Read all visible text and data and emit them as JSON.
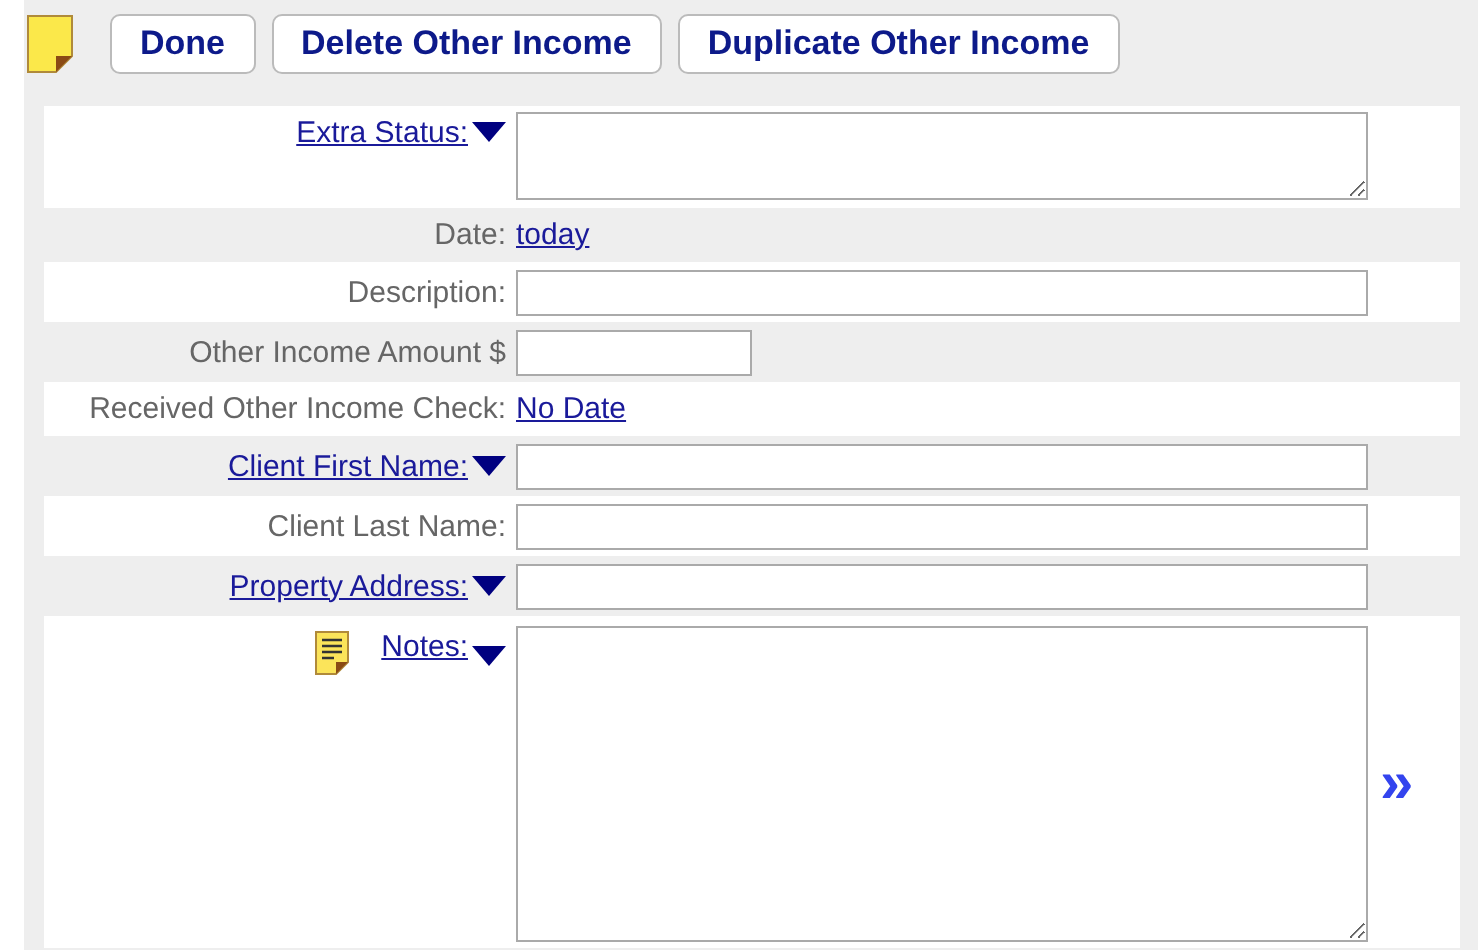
{
  "toolbar": {
    "buttons": [
      "Done",
      "Delete Other Income",
      "Duplicate Other Income"
    ]
  },
  "form": {
    "rows": [
      {
        "label": "Extra Status:",
        "label_is_link": true,
        "dropdown": true,
        "kind": "textarea"
      },
      {
        "label": "Date:",
        "label_is_link": false,
        "dropdown": false,
        "kind": "link",
        "value": "today"
      },
      {
        "label": "Description:",
        "label_is_link": false,
        "dropdown": false,
        "kind": "input"
      },
      {
        "label": "Other Income Amount $",
        "label_is_link": false,
        "dropdown": false,
        "kind": "short-input"
      },
      {
        "label": "Received Other Income Check:",
        "label_is_link": false,
        "dropdown": false,
        "kind": "link",
        "value": "No Date"
      },
      {
        "label": "Client First Name:",
        "label_is_link": true,
        "dropdown": true,
        "kind": "input"
      },
      {
        "label": "Client Last Name:",
        "label_is_link": false,
        "dropdown": false,
        "kind": "input"
      },
      {
        "label": "Property Address:",
        "label_is_link": true,
        "dropdown": true,
        "kind": "input"
      },
      {
        "label": "Notes:",
        "label_is_link": true,
        "dropdown": true,
        "kind": "notes",
        "expand": "»"
      }
    ]
  }
}
